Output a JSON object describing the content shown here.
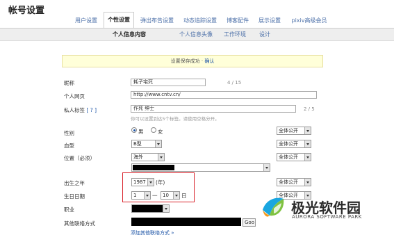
{
  "page": {
    "title": "帐号设置"
  },
  "tabs": [
    {
      "label": "用户设置"
    },
    {
      "label": "个性设置"
    },
    {
      "label": "弹出布告设置"
    },
    {
      "label": "动态追踪设置"
    },
    {
      "label": "博客配件"
    },
    {
      "label": "展示设置"
    },
    {
      "label": "pixiv高级会员"
    }
  ],
  "subtabs": [
    {
      "label": "个人信息内容"
    },
    {
      "label": "个人信息头像"
    },
    {
      "label": "工作环境"
    },
    {
      "label": "设计"
    }
  ],
  "notice": {
    "text": "设置保存成功 · ",
    "link": "确认"
  },
  "form": {
    "nickname": {
      "label": "昵称",
      "value": "耗子宅死",
      "counter": "4 / 15"
    },
    "homepage": {
      "label": "个人网页",
      "value": "http://www.cntv.cn/"
    },
    "tags": {
      "label": "私人标签",
      "help": "[ ? ]",
      "value": "作死 绅士",
      "counter": "2 / 5",
      "hint": "你可以设置到达5个标签。请使用空格分开。"
    },
    "gender": {
      "label": "性别",
      "male": "男",
      "female": "女",
      "selected": "male",
      "privacy": "全体公开"
    },
    "blood": {
      "label": "血型",
      "value": "B型",
      "privacy": "全体公开"
    },
    "location": {
      "label": "位置（必须）",
      "value": "海外",
      "privacy": "全体公开"
    },
    "birth_year": {
      "label": "出生之年",
      "value": "1987",
      "unit": "(年)",
      "privacy": "全体公开"
    },
    "birthday": {
      "label": "生日日期",
      "month": "1",
      "sep": "一",
      "day": "10",
      "unit": "日",
      "privacy": "全体公开"
    },
    "job": {
      "label": "职业"
    },
    "contact": {
      "label": "其他联络方式",
      "button": "Goo",
      "add_link": "添加其他联络方式 »"
    }
  },
  "watermark": {
    "title": "极光软件园",
    "subtitle": "AURORA SOFTWARE PARK"
  }
}
